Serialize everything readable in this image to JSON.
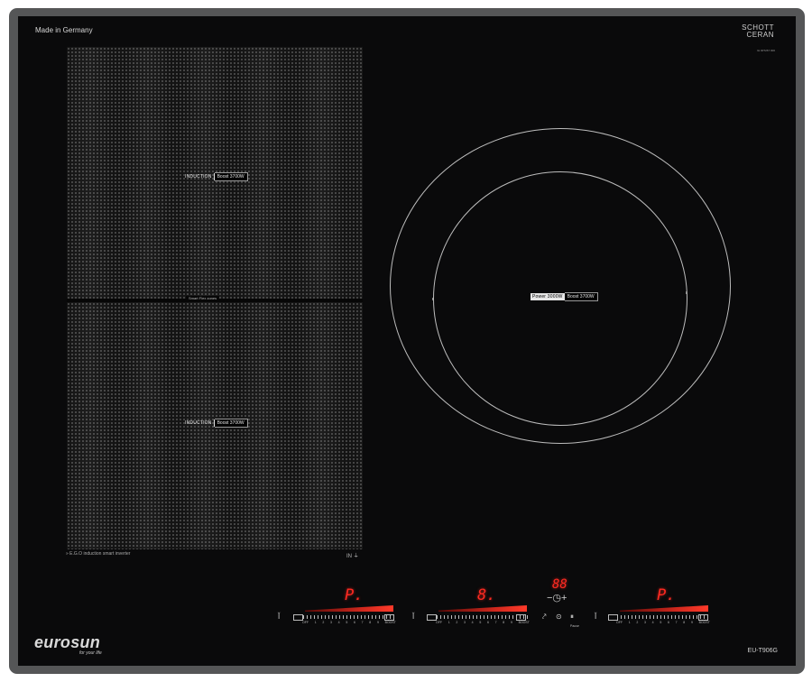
{
  "brand": {
    "made_in": "Made in Germany",
    "glass_maker_line1": "SCHOTT",
    "glass_maker_line2": "CERAN",
    "serial": "IH 00T267 000",
    "logo": "eurosun",
    "slogan": "for your life",
    "model": "EU-T906G"
  },
  "left_zones": {
    "top_badge_label": "INDUCTION",
    "top_badge_boost": "Boost 3700W",
    "bottom_badge_label": "INDUCTION",
    "bottom_badge_boost": "Boost 3700W",
    "bridge_label": "Smart Flex zones",
    "eco_label": "E.G.O induction smart inverter",
    "in_label": "IN"
  },
  "right_zone": {
    "power_label": "Power 3000W",
    "boost_label": "Boost 3700W"
  },
  "controls": {
    "left_display": "P.",
    "middle_display": "8.",
    "timer_display": "88",
    "right_display": "P.",
    "timer_symbols": "−◷+",
    "pause_label": "Pause",
    "scale_numbers": [
      "OFF",
      "1",
      "2",
      "3",
      "4",
      "5",
      "6",
      "7",
      "8",
      "9",
      "BOOST"
    ]
  },
  "colors": {
    "glass": "#0a0a0b",
    "frame": "#555657",
    "display_red": "#ff2a22"
  }
}
